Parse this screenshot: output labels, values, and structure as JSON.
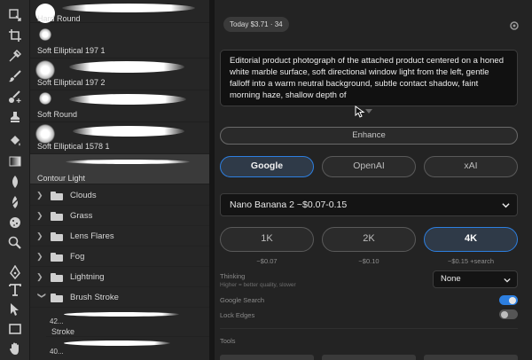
{
  "brushes": {
    "items": [
      {
        "name": "Hard Round",
        "selected": false
      },
      {
        "name": "Soft Elliptical 197 1",
        "selected": false
      },
      {
        "name": "Soft Elliptical 197 2",
        "selected": false
      },
      {
        "name": "Soft Round",
        "selected": false
      },
      {
        "name": "Soft Elliptical 1578 1",
        "selected": false
      },
      {
        "name": "Contour Light",
        "selected": true
      }
    ],
    "folders": [
      "Clouds",
      "Grass",
      "Lens Flares",
      "Fog",
      "Lightning",
      "Brush Stroke"
    ],
    "brush_stroke_items": [
      {
        "size": "42...",
        "label": "Stroke"
      },
      {
        "size": "40...",
        "label": ""
      }
    ]
  },
  "tools": {
    "icons": [
      "artboard-tool-icon",
      "crop-tool-icon",
      "eyedropper-tool-icon",
      "brush-tool-icon",
      "healing-brush-tool-icon",
      "stamp-tool-icon",
      "paint-bucket-tool-icon",
      "gradient-tool-icon",
      "smudge-tool-icon",
      "dodge-tool-icon",
      "sponge-tool-icon",
      "burn-tool-icon",
      "pen-tool-icon",
      "type-tool-icon",
      "path-select-tool-icon",
      "rectangle-tool-icon",
      "hand-tool-icon"
    ]
  },
  "ai_panel": {
    "usage": "Today $3.71 · 34",
    "prompt": "Editorial product photograph of the attached product centered on a honed white marble surface, soft directional window light from the left, gentle falloff into a warm neutral background, subtle contact shadow, faint morning haze, shallow depth of",
    "enhance_label": "Enhance",
    "providers": [
      {
        "label": "Google",
        "active": true
      },
      {
        "label": "OpenAI",
        "active": false
      },
      {
        "label": "xAI",
        "active": false
      }
    ],
    "model": "Nano Banana 2 ~$0.07-0.15",
    "resolutions": [
      {
        "label": "1K",
        "price": "~$0.07",
        "active": false
      },
      {
        "label": "2K",
        "price": "~$0.10",
        "active": false
      },
      {
        "label": "4K",
        "price": "~$0.15 +search",
        "active": true
      }
    ],
    "thinking_label": "Thinking",
    "thinking_sub": "Higher = better quality, slower",
    "thinking_value": "None",
    "google_search_label": "Google Search",
    "google_search_on": true,
    "lock_edges_label": "Lock Edges",
    "lock_edges_on": false,
    "tools_label": "Tools"
  },
  "colors": {
    "accent": "#2d7fe0",
    "panel_bg": "#232323",
    "prompt_bg": "#111111"
  }
}
